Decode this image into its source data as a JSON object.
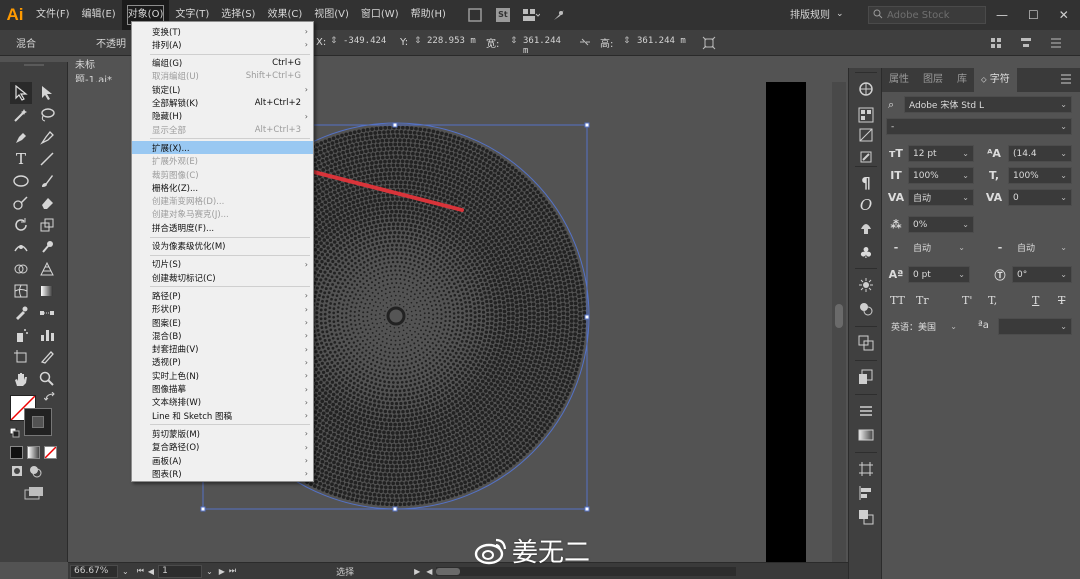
{
  "app": {
    "logo": "Ai"
  },
  "menubar": {
    "items": [
      "文件(F)",
      "编辑(E)",
      "对象(O)",
      "文字(T)",
      "选择(S)",
      "效果(C)",
      "视图(V)",
      "窗口(W)",
      "帮助(H)"
    ],
    "active_index": 2,
    "st_badge": "St",
    "workspace": "排版规则",
    "search_placeholder": "Adobe Stock",
    "window_controls": [
      "—",
      "☐",
      "✕"
    ]
  },
  "controlbar": {
    "mode_label": "混合",
    "opacity_label": "不透明",
    "x_label": "X:",
    "x_value": "-349.424",
    "y_label": "Y:",
    "y_value": "228.953 m",
    "w_label": "宽:",
    "w_value": "361.244 m",
    "h_label": "高:",
    "h_value": "361.244 m"
  },
  "document": {
    "tab_title": "未标题-1.ai*"
  },
  "statusbar": {
    "zoom": "66.67%",
    "page": "1",
    "tool": "选择"
  },
  "object_menu": {
    "items": [
      {
        "label": "变换(T)",
        "shortcut": "",
        "submenu": true,
        "disabled": false
      },
      {
        "label": "排列(A)",
        "shortcut": "",
        "submenu": true,
        "disabled": false
      },
      {
        "sep": true
      },
      {
        "label": "编组(G)",
        "shortcut": "Ctrl+G",
        "submenu": false,
        "disabled": false
      },
      {
        "label": "取消编组(U)",
        "shortcut": "Shift+Ctrl+G",
        "submenu": false,
        "disabled": true
      },
      {
        "label": "锁定(L)",
        "shortcut": "",
        "submenu": true,
        "disabled": false
      },
      {
        "label": "全部解锁(K)",
        "shortcut": "Alt+Ctrl+2",
        "submenu": false,
        "disabled": false
      },
      {
        "label": "隐藏(H)",
        "shortcut": "",
        "submenu": true,
        "disabled": false
      },
      {
        "label": "显示全部",
        "shortcut": "Alt+Ctrl+3",
        "submenu": false,
        "disabled": true
      },
      {
        "sep": true
      },
      {
        "label": "扩展(X)...",
        "shortcut": "",
        "submenu": false,
        "disabled": false,
        "highlight": true
      },
      {
        "label": "扩展外观(E)",
        "shortcut": "",
        "submenu": false,
        "disabled": true
      },
      {
        "label": "裁剪图像(C)",
        "shortcut": "",
        "submenu": false,
        "disabled": true
      },
      {
        "label": "栅格化(Z)...",
        "shortcut": "",
        "submenu": false,
        "disabled": false
      },
      {
        "label": "创建渐变网格(D)...",
        "shortcut": "",
        "submenu": false,
        "disabled": true
      },
      {
        "label": "创建对象马赛克(J)...",
        "shortcut": "",
        "submenu": false,
        "disabled": true
      },
      {
        "label": "拼合透明度(F)...",
        "shortcut": "",
        "submenu": false,
        "disabled": false
      },
      {
        "sep": true
      },
      {
        "label": "设为像素级优化(M)",
        "shortcut": "",
        "submenu": false,
        "disabled": false
      },
      {
        "sep": true
      },
      {
        "label": "切片(S)",
        "shortcut": "",
        "submenu": true,
        "disabled": false
      },
      {
        "label": "创建裁切标记(C)",
        "shortcut": "",
        "submenu": false,
        "disabled": false
      },
      {
        "sep": true
      },
      {
        "label": "路径(P)",
        "shortcut": "",
        "submenu": true,
        "disabled": false
      },
      {
        "label": "形状(P)",
        "shortcut": "",
        "submenu": true,
        "disabled": false
      },
      {
        "label": "图案(E)",
        "shortcut": "",
        "submenu": true,
        "disabled": false
      },
      {
        "label": "混合(B)",
        "shortcut": "",
        "submenu": true,
        "disabled": false
      },
      {
        "label": "封套扭曲(V)",
        "shortcut": "",
        "submenu": true,
        "disabled": false
      },
      {
        "label": "透视(P)",
        "shortcut": "",
        "submenu": true,
        "disabled": false
      },
      {
        "label": "实时上色(N)",
        "shortcut": "",
        "submenu": true,
        "disabled": false
      },
      {
        "label": "图像描摹",
        "shortcut": "",
        "submenu": true,
        "disabled": false
      },
      {
        "label": "文本绕排(W)",
        "shortcut": "",
        "submenu": true,
        "disabled": false
      },
      {
        "label": "Line 和 Sketch 图稿",
        "shortcut": "",
        "submenu": true,
        "disabled": false
      },
      {
        "sep": true
      },
      {
        "label": "剪切蒙版(M)",
        "shortcut": "",
        "submenu": true,
        "disabled": false
      },
      {
        "label": "复合路径(O)",
        "shortcut": "",
        "submenu": true,
        "disabled": false
      },
      {
        "label": "画板(A)",
        "shortcut": "",
        "submenu": true,
        "disabled": false
      },
      {
        "label": "图表(R)",
        "shortcut": "",
        "submenu": true,
        "disabled": false
      }
    ]
  },
  "char_panel": {
    "tabs": [
      "属性",
      "图层",
      "库",
      "字符"
    ],
    "active_tab": 3,
    "font_family": "Adobe 宋体 Std L",
    "font_style": "-",
    "font_size": "12 pt",
    "leading": "(14.4",
    "vscale": "100%",
    "hscale": "100%",
    "kerning": "自动",
    "tracking": "0",
    "tsume": "0%",
    "aki_left": "自动",
    "aki_right": "自动",
    "baseline": "0 pt",
    "rotation": "0°",
    "tt_buttons": [
      "TT",
      "Tr",
      "T'",
      "T,",
      "T",
      "T"
    ],
    "language": "英语：美国",
    "aa_label": "ªa"
  },
  "watermark": {
    "text": "姜无二"
  },
  "colors": {
    "accent_arrow": "#d9343a",
    "selection_blue": "#5472c6",
    "highlight": "#99c8f2",
    "logo": "#ff9a00"
  }
}
